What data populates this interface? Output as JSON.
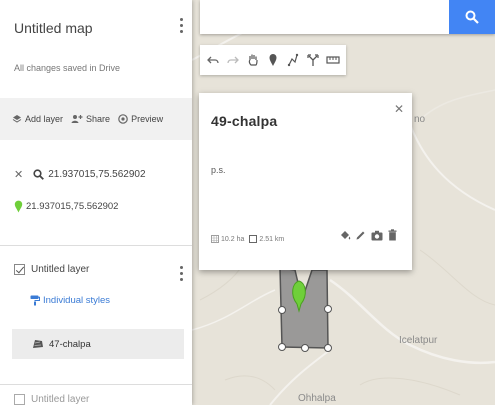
{
  "map": {
    "place_labels": [
      "Icelatpur",
      "Ohhalpa",
      "no"
    ]
  },
  "search": {
    "placeholder": ""
  },
  "toolbar": {
    "tools": [
      "undo-icon",
      "redo-icon",
      "hand-icon",
      "marker-icon",
      "line-icon",
      "directions-icon",
      "ruler-icon"
    ]
  },
  "panel": {
    "map_title": "Untitled map",
    "save_status": "All changes saved in Drive",
    "actions": {
      "add_layer": "Add layer",
      "share": "Share",
      "preview": "Preview"
    },
    "search_result": {
      "query": "21.937015,75.562902",
      "result": "21.937015,75.562902"
    },
    "layer": {
      "name": "Untitled layer",
      "styles_label": "Individual styles",
      "feature": "47-chalpa"
    },
    "next_layer": "Untitled layer"
  },
  "popup": {
    "title": "49-chalpa",
    "description": "p.s.",
    "area": "10.2 ha",
    "perimeter": "2.51 km"
  },
  "colors": {
    "search_button": "#4285f4",
    "marker": "#6fcf3a",
    "polygon_fill": "#8c8c8c",
    "link": "#3a7bd5"
  }
}
